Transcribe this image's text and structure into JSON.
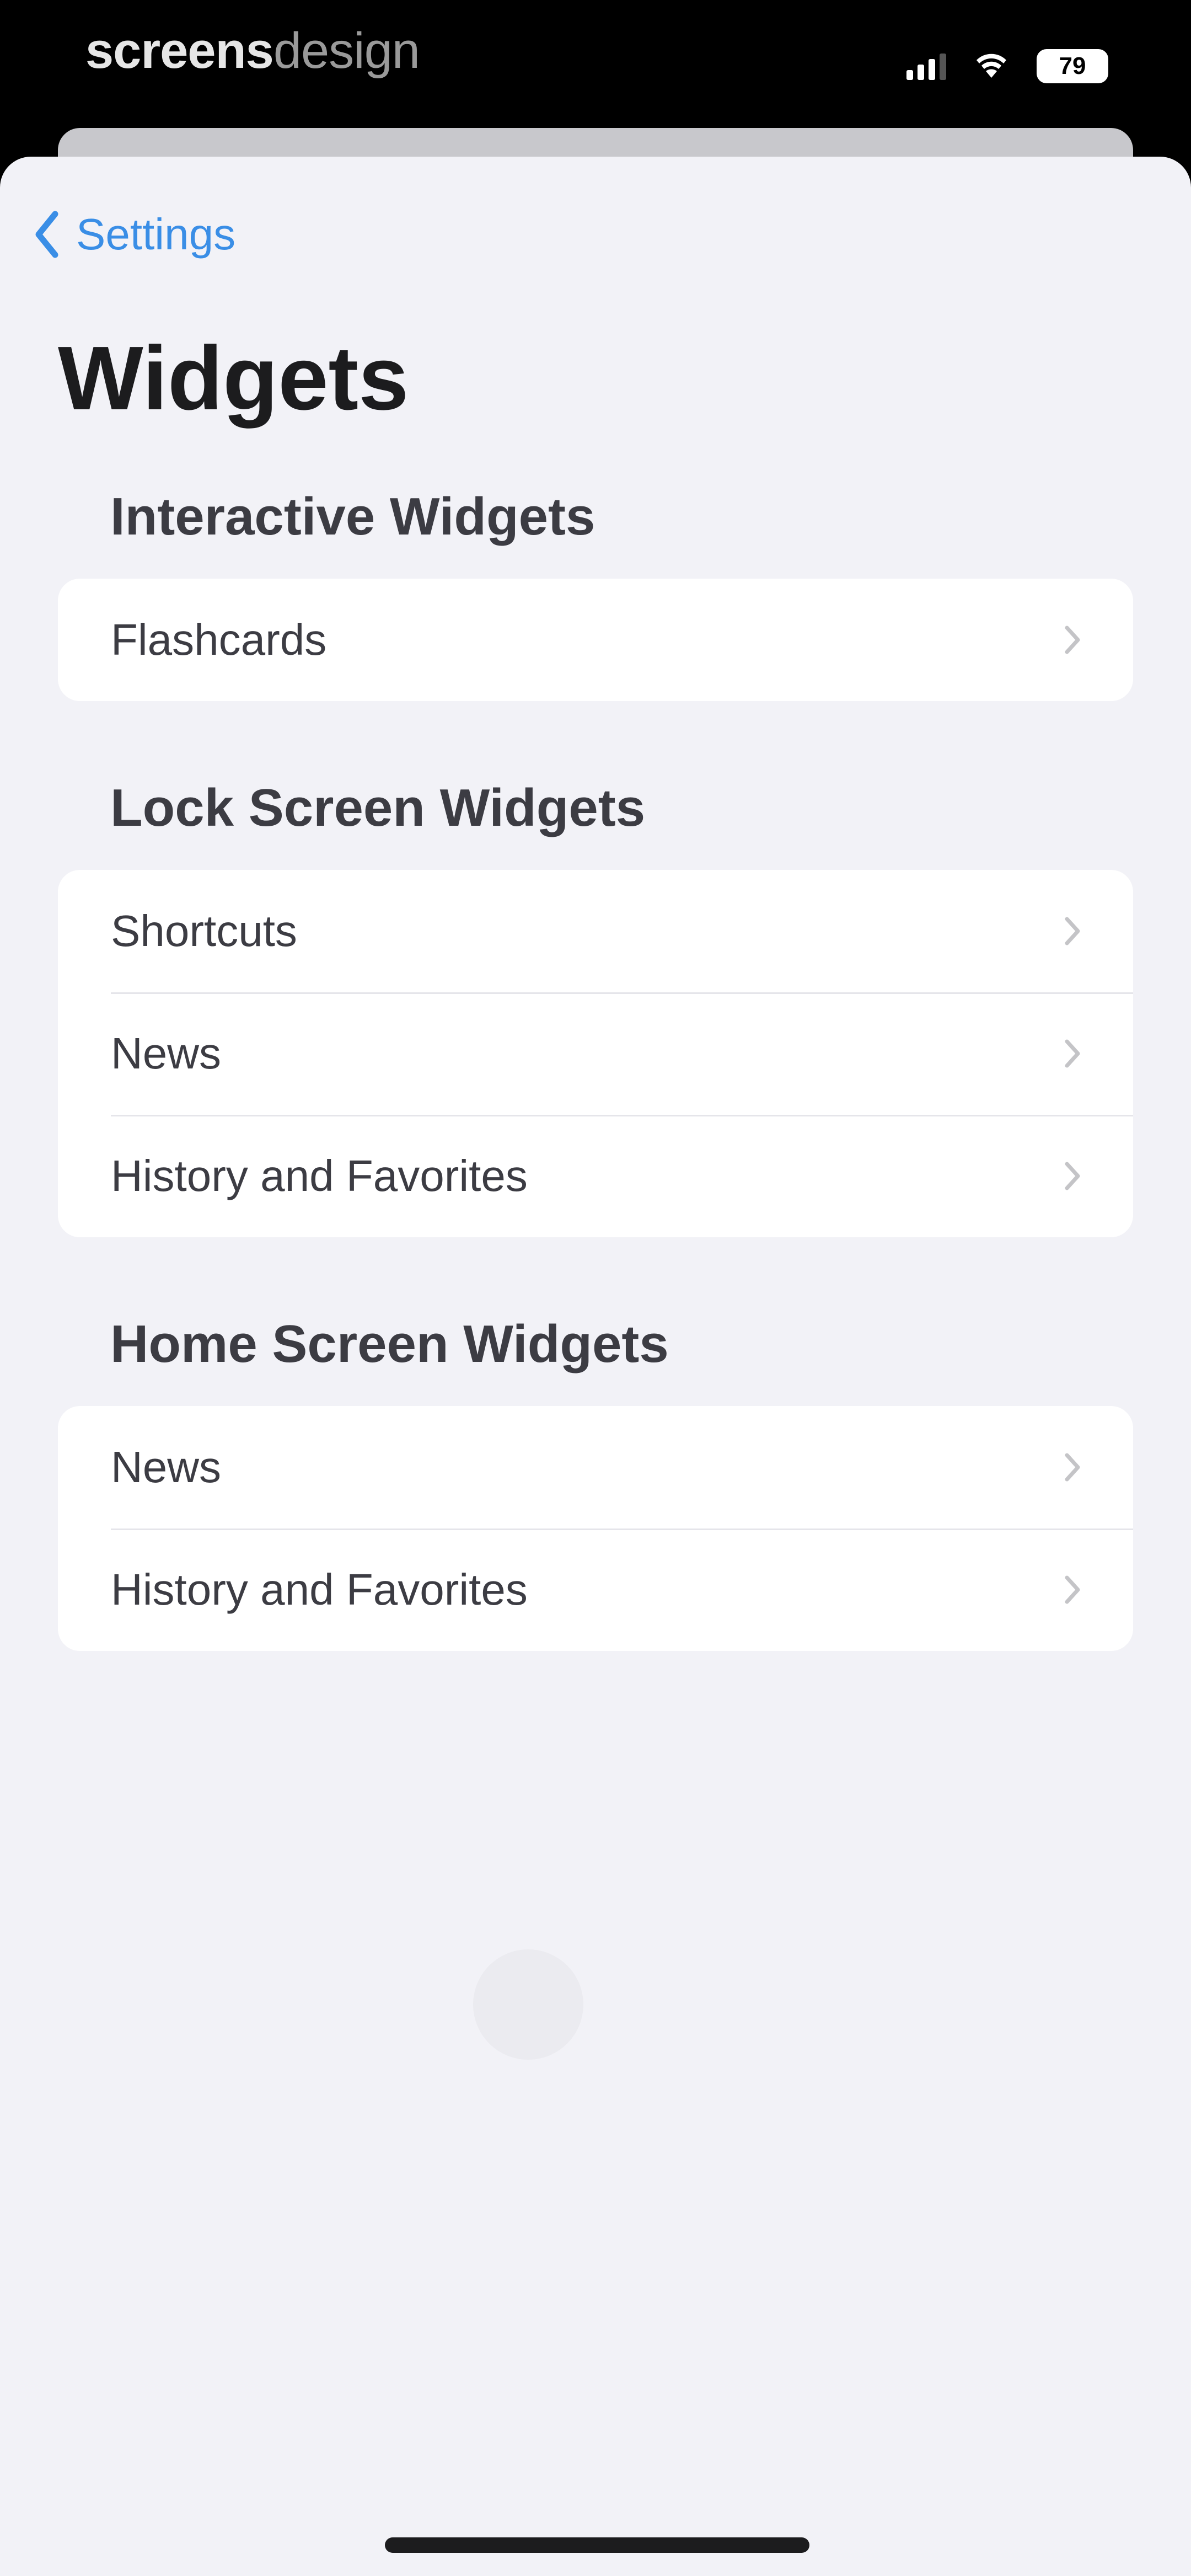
{
  "status_bar": {
    "watermark_bold": "screens",
    "watermark_light": "design",
    "battery_level": "79"
  },
  "nav": {
    "back_label": "Settings",
    "accent_color": "#3a8ee6"
  },
  "page": {
    "title": "Widgets"
  },
  "sections": [
    {
      "header": "Interactive Widgets",
      "items": [
        {
          "label": "Flashcards"
        }
      ]
    },
    {
      "header": "Lock Screen Widgets",
      "items": [
        {
          "label": "Shortcuts"
        },
        {
          "label": "News"
        },
        {
          "label": "History and Favorites"
        }
      ]
    },
    {
      "header": "Home Screen Widgets",
      "items": [
        {
          "label": "News"
        },
        {
          "label": "History and Favorites"
        }
      ]
    }
  ],
  "icons": {
    "back": "chevron-left-icon",
    "row": "chevron-right-icon",
    "signal": "cellular-signal-icon",
    "wifi": "wifi-icon",
    "battery": "battery-icon"
  }
}
